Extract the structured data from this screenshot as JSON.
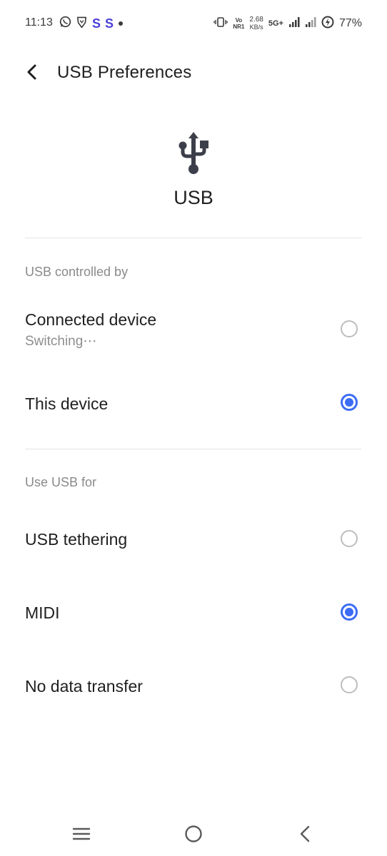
{
  "status_bar": {
    "time": "11:13",
    "app_icons": [
      "whatsapp-icon",
      "brave-icon",
      "s-app-icon",
      "s-app-icon",
      "notification-dot"
    ],
    "s_letter": "S",
    "volte_top": "Vo",
    "volte_bottom": "NR1",
    "net_speed_value": "2.68",
    "net_speed_unit": "KB/s",
    "network_type": "5G+",
    "battery_percent": "77%"
  },
  "header": {
    "title": "USB Preferences"
  },
  "hero": {
    "label": "USB",
    "icon": "usb-icon"
  },
  "controlled_by": {
    "section_title": "USB controlled by",
    "options": [
      {
        "label": "Connected device",
        "sublabel": "Switching⋯",
        "selected": false
      },
      {
        "label": "This device",
        "selected": true
      }
    ]
  },
  "use_usb_for": {
    "section_title": "Use USB for",
    "options": [
      {
        "label": "USB tethering",
        "selected": false
      },
      {
        "label": "MIDI",
        "selected": true
      },
      {
        "label": "No data transfer",
        "selected": false
      }
    ]
  },
  "colors": {
    "accent": "#3b6cf4",
    "s_app": "#4a3fd8",
    "text_primary": "#1f1f1f",
    "text_secondary": "#8a8a8a",
    "divider": "#e4e4e4"
  },
  "nav_bar": {
    "buttons": [
      "menu-icon",
      "home-icon",
      "back-icon"
    ]
  }
}
